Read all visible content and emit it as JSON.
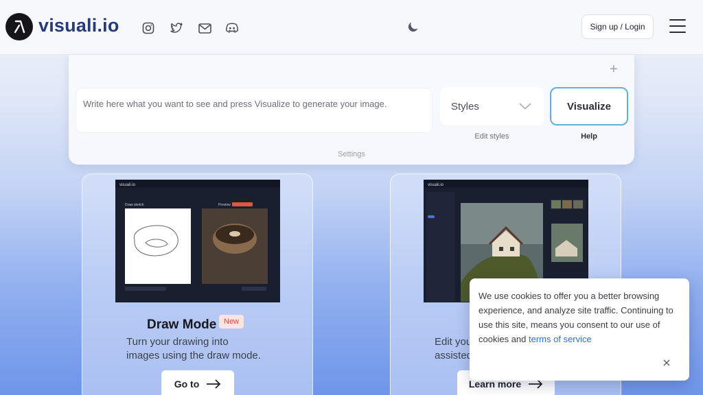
{
  "header": {
    "logo_text": "visuali.io",
    "social_icons": [
      "instagram-icon",
      "twitter-icon",
      "mail-icon",
      "discord-icon"
    ],
    "theme_icon": "moon-icon",
    "signup_label": "Sign up / Login",
    "menu_icon": "hamburger-menu-icon"
  },
  "prompt_panel": {
    "prompt_placeholder": "Write here what you want to see and press Visualize to generate your image.",
    "styles_label": "Styles",
    "visualize_label": "Visualize",
    "edit_styles_label": "Edit styles",
    "help_label": "Help",
    "settings_label": "Settings"
  },
  "cards": [
    {
      "title": "Draw Mode",
      "badge": "New",
      "description_line1": "Turn your drawing into",
      "description_line2": "images using the draw mode.",
      "button_label": "Go to",
      "screenshot_logo": "visuali.io",
      "sketch_label": "Draw sketch",
      "preview_label": "Preview"
    },
    {
      "description_line1": "Edit your",
      "description_line2": "assisted",
      "button_label": "Learn more",
      "screenshot_logo": "visuali.io"
    }
  ],
  "cookie_banner": {
    "text": "We use cookies to offer you a better browsing experience, and analyze site traffic. Continuing to use this site, means you consent to our use of cookies and",
    "link_text": "terms of service"
  },
  "colors": {
    "brand": "#283a78",
    "accent_border": "#5fb0de",
    "link": "#2f6fd8",
    "badge_text": "#e0433b",
    "badge_bg": "#fde3e1"
  }
}
